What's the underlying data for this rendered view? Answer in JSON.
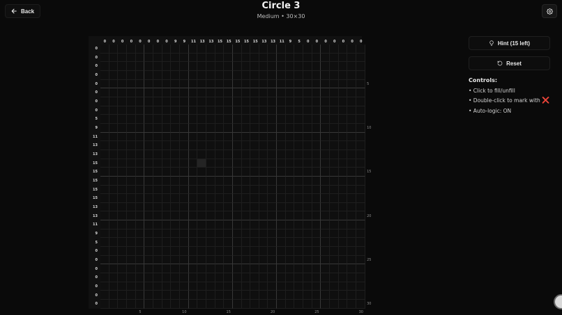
{
  "header": {
    "back_label": "Back",
    "title": "Circle 3",
    "subtitle": "Medium • 30×30"
  },
  "puzzle": {
    "size": 30,
    "column_clues": [
      0,
      0,
      0,
      0,
      0,
      0,
      0,
      0,
      9,
      9,
      11,
      13,
      13,
      15,
      15,
      15,
      15,
      15,
      13,
      13,
      11,
      9,
      5,
      0,
      0,
      0,
      0,
      0,
      0,
      0
    ],
    "row_clues": [
      0,
      0,
      0,
      0,
      0,
      0,
      0,
      0,
      5,
      9,
      11,
      13,
      13,
      15,
      15,
      15,
      15,
      15,
      13,
      13,
      11,
      9,
      5,
      0,
      0,
      0,
      0,
      0,
      0,
      0
    ],
    "column_numbers": [
      "5",
      "10",
      "15",
      "20",
      "25",
      "30"
    ],
    "row_numbers": [
      "5",
      "10",
      "15",
      "20",
      "25",
      "30"
    ],
    "highlighted_cell": {
      "row": 13,
      "col": 11
    }
  },
  "panel": {
    "hint_label": "Hint (15 left)",
    "reset_label": "Reset",
    "controls_title": "Controls:",
    "controls": [
      "• Click to fill/unfill",
      "• Double-click to mark with",
      "• Auto-logic: ON"
    ],
    "mark_symbol": "❌"
  },
  "colors": {
    "background": "#0a0a0a",
    "board": "#111111",
    "mark": "#e53935"
  }
}
